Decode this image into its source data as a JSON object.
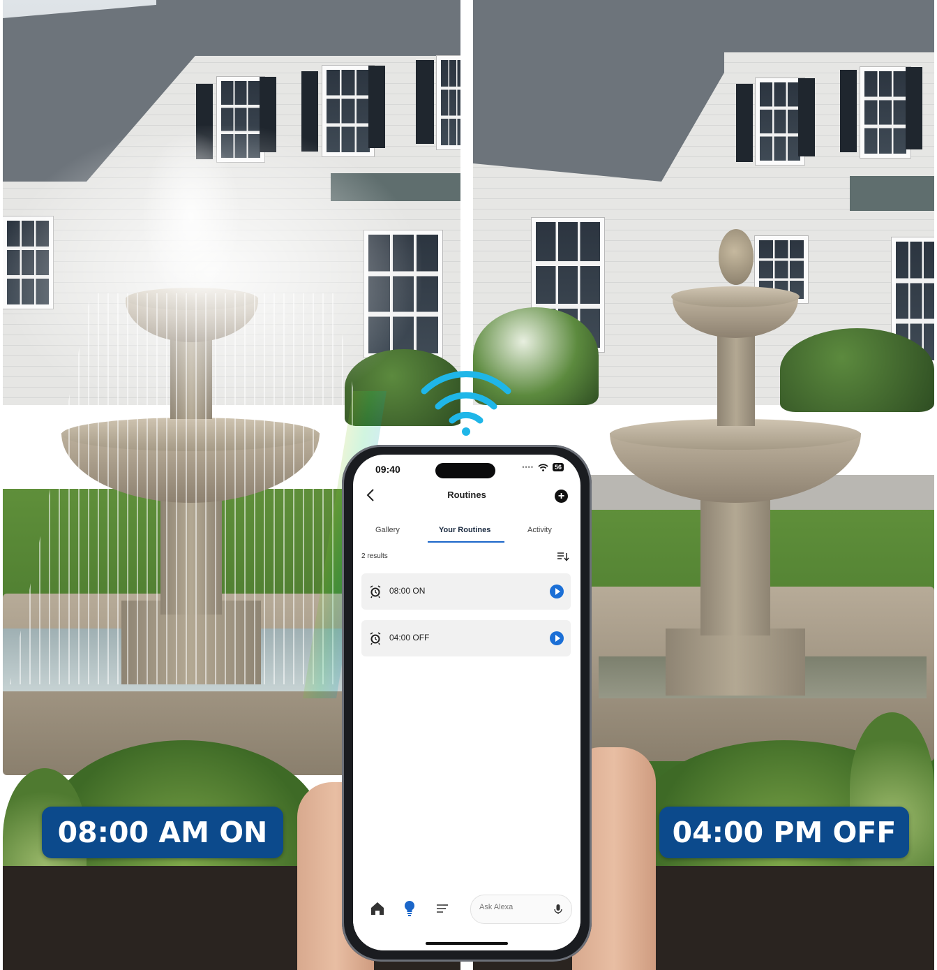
{
  "overlay": {
    "left_badge": "08:00 AM ON",
    "right_badge": "04:00 PM OFF",
    "badge_color": "#0c4a8c",
    "signal_icon": "wifi-signal-icon",
    "signal_color": "#1fb6e8"
  },
  "phone": {
    "status": {
      "time": "09:40",
      "battery": "56"
    },
    "header": {
      "title": "Routines",
      "back_icon": "chevron-left-icon",
      "add_icon": "plus-circle-icon"
    },
    "tabs": [
      {
        "label": "Gallery",
        "active": false
      },
      {
        "label": "Your Routines",
        "active": true
      },
      {
        "label": "Activity",
        "active": false
      }
    ],
    "results_count": "2 results",
    "routines": [
      {
        "label": "08:00 ON",
        "icon": "alarm-clock-icon",
        "action_icon": "play-icon"
      },
      {
        "label": "04:00 OFF",
        "icon": "alarm-clock-icon",
        "action_icon": "play-icon"
      }
    ],
    "bottom_nav": {
      "items": [
        "home-icon",
        "lightbulb-icon",
        "menu-icon"
      ],
      "ask_placeholder": "Ask Alexa",
      "mic_icon": "microphone-icon"
    },
    "accent_color": "#1b66c9"
  }
}
